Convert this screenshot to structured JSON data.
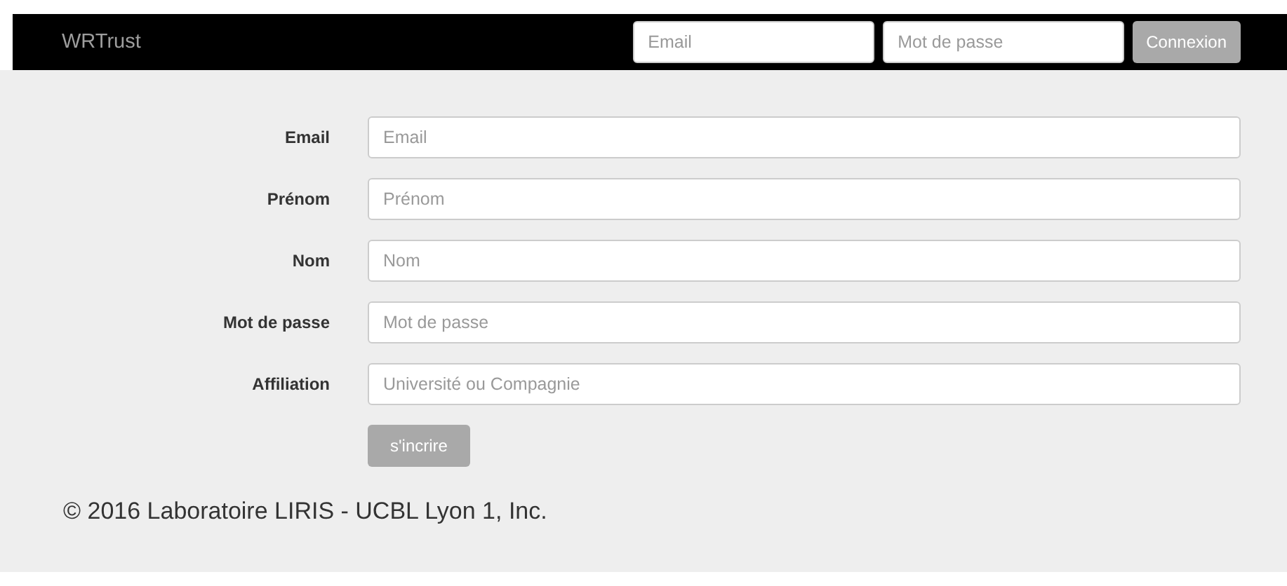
{
  "navbar": {
    "brand": "WRTrust",
    "email": {
      "placeholder": "Email"
    },
    "password": {
      "placeholder": "Mot de passe"
    },
    "login_button": {
      "label": "Connexion",
      "disabled": true
    }
  },
  "form": {
    "fields": [
      {
        "label": "Email",
        "placeholder": "Email"
      },
      {
        "label": "Prénom",
        "placeholder": "Prénom"
      },
      {
        "label": "Nom",
        "placeholder": "Nom"
      },
      {
        "label": "Mot de passe",
        "placeholder": "Mot de passe"
      },
      {
        "label": "Affiliation",
        "placeholder": "Université ou Compagnie"
      }
    ],
    "submit": {
      "label": "s'incrire",
      "disabled": true
    }
  },
  "footer": "© 2016 Laboratoire LIRIS - UCBL Lyon 1, Inc."
}
